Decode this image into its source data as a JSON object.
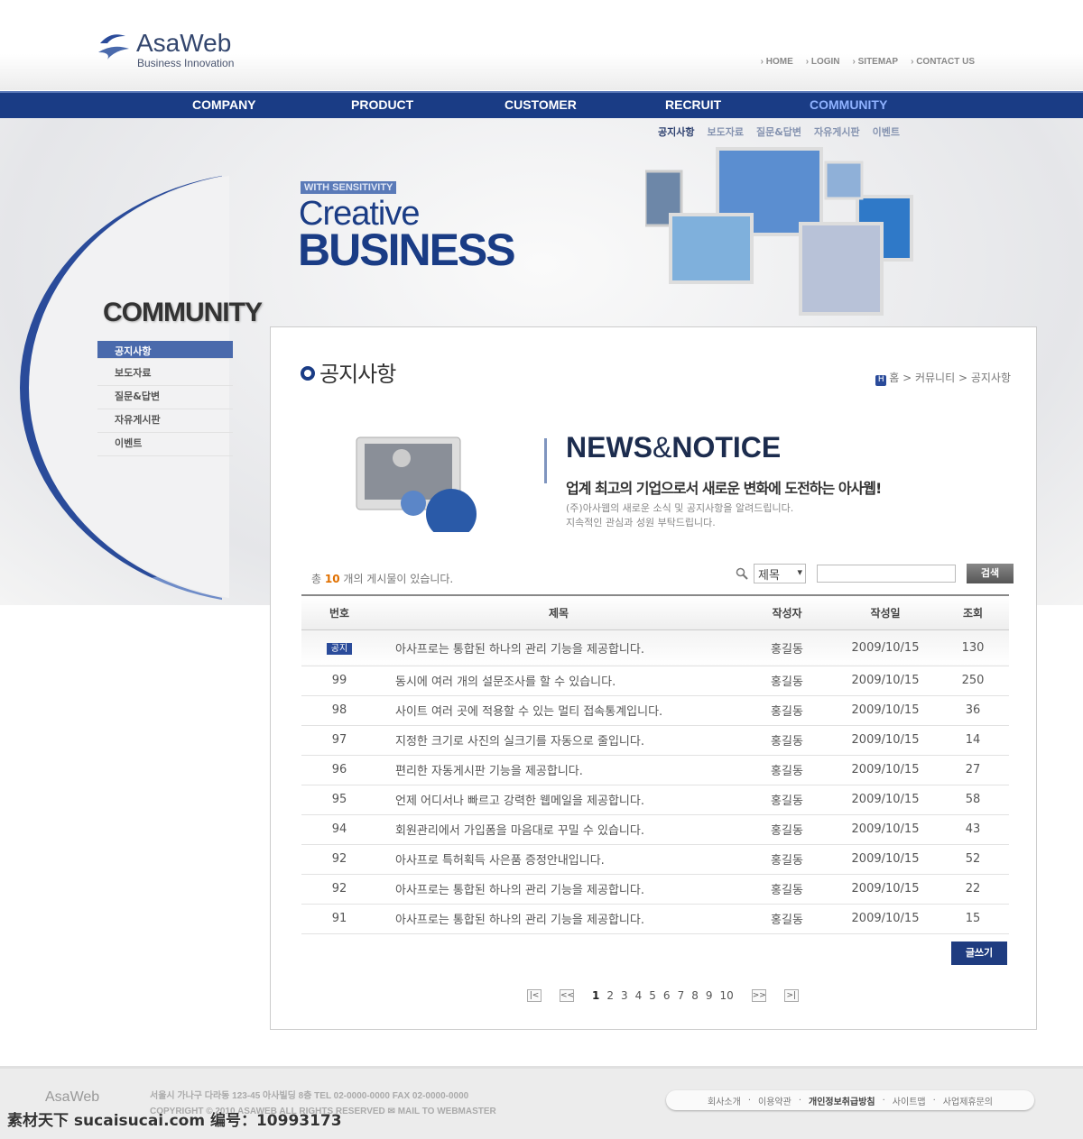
{
  "brand": {
    "name": "AsaWeb",
    "tagline": "Business Innovation"
  },
  "util_links": [
    "HOME",
    "LOGIN",
    "SITEMAP",
    "CONTACT US"
  ],
  "gnb": [
    "COMPANY",
    "PRODUCT",
    "CUSTOMER",
    "RECRUIT",
    "COMMUNITY"
  ],
  "sub_nav": [
    "공지사항",
    "보도자료",
    "질문&답변",
    "자유게시판",
    "이벤트"
  ],
  "hero": {
    "badge": "WITH SENSITIVITY",
    "line1": "Creative",
    "line2": "BUSINESS"
  },
  "sidebar": {
    "title": "COMMUNITY",
    "items": [
      "공지사항",
      "보도자료",
      "질문&답변",
      "자유게시판",
      "이벤트"
    ]
  },
  "page": {
    "title": "공지사항",
    "breadcrumb": [
      "홈",
      "커뮤니티",
      "공지사항"
    ],
    "home_icon": "H"
  },
  "intro": {
    "heading_a": "NEWS",
    "heading_amp": "&",
    "heading_b": "NOTICE",
    "subtitle": "업계 최고의 기업으로서 새로운 변화에 도전하는 아사웹!",
    "desc1": "(주)아사웹의 새로운 소식 및 공지사항을 알려드립니다.",
    "desc2": "지속적인 관심과 성원 부탁드립니다."
  },
  "board": {
    "total_prefix": "총",
    "total": "10",
    "total_suffix": "개의 게시물이 있습니다.",
    "search_field": "제목",
    "search_value": "",
    "search_button": "검색",
    "columns": [
      "번호",
      "제목",
      "작성자",
      "작성일",
      "조회"
    ],
    "rows": [
      [
        "공지",
        "아사프로는 통합된 하나의 관리 기능을 제공합니다.",
        "홍길동",
        "2009/10/15",
        "130"
      ],
      [
        "99",
        "동시에 여러 개의 설문조사를 할 수 있습니다.",
        "홍길동",
        "2009/10/15",
        "250"
      ],
      [
        "98",
        "사이트 여러 곳에 적용할 수 있는 멀티 접속통계입니다.",
        "홍길동",
        "2009/10/15",
        "36"
      ],
      [
        "97",
        "지정한 크기로 사진의 실크기를 자동으로 줄입니다.",
        "홍길동",
        "2009/10/15",
        "14"
      ],
      [
        "96",
        "편리한 자동게시판 기능을 제공합니다.",
        "홍길동",
        "2009/10/15",
        "27"
      ],
      [
        "95",
        "언제 어디서나 빠르고 강력한 웹메일을 제공합니다.",
        "홍길동",
        "2009/10/15",
        "58"
      ],
      [
        "94",
        "회원관리에서 가입폼을 마음대로 꾸밀 수 있습니다.",
        "홍길동",
        "2009/10/15",
        "43"
      ],
      [
        "92",
        "아사프로 특허획득 사은품 증정안내입니다.",
        "홍길동",
        "2009/10/15",
        "52"
      ],
      [
        "92",
        "아사프로는 통합된 하나의 관리 기능을 제공합니다.",
        "홍길동",
        "2009/10/15",
        "22"
      ],
      [
        "91",
        "아사프로는 통합된 하나의 관리 기능을 제공합니다.",
        "홍길동",
        "2009/10/15",
        "15"
      ]
    ],
    "write_button": "글쓰기"
  },
  "pager": {
    "first": "|<",
    "prev": "<<",
    "pages": [
      "1",
      "2",
      "3",
      "4",
      "5",
      "6",
      "7",
      "8",
      "9",
      "10"
    ],
    "current": "1",
    "next": ">>",
    "last": ">|"
  },
  "footer": {
    "logo": "AsaWeb",
    "address": "서울시 가나구 다라동 123-45 아사빌딩 8층    TEL 02-0000-0000    FAX 02-0000-0000",
    "copyright": "COPYRIGHT © 2010 ASAWEB ALL RIGHTS RESERVED  ✉ MAIL TO WEBMASTER",
    "links": [
      "회사소개",
      "이용약관",
      "개인정보취급방침",
      "사이트맵",
      "사업제휴문의"
    ]
  },
  "watermark": "素材天下 sucaisucai.com  编号：10993173",
  "colors": {
    "primary": "#1a3c85",
    "accent": "#8fb2ff",
    "highlight": "#e07000"
  }
}
